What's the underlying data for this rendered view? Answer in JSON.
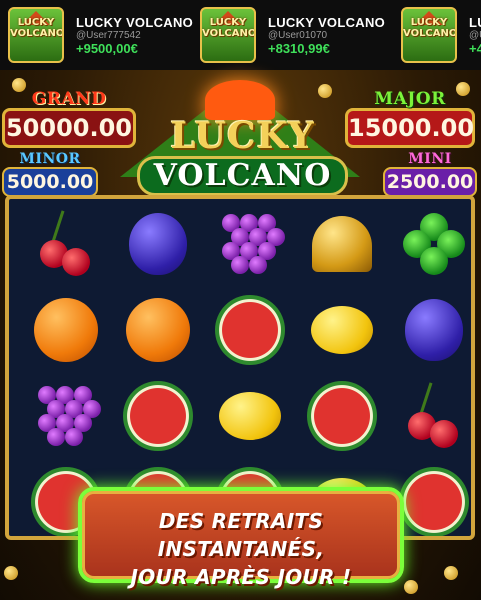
{
  "ticker": [
    {
      "game": "LUCKY VOLCANO",
      "thumb_text": "LUCKY VOLCANO",
      "user": "@User777542",
      "amount": "+9500,00€"
    },
    {
      "game": "LUCKY VOLCANO",
      "thumb_text": "LUCKY VOLCANO",
      "user": "@User01070",
      "amount": "+8310,99€"
    },
    {
      "game": "LU",
      "thumb_text": "LUCKY VOLCANO",
      "user": "@U",
      "amount": "+4"
    }
  ],
  "logo": {
    "line1": "LUCKY",
    "line2": "VOLCANO"
  },
  "jackpots": {
    "grand": {
      "label": "GRAND",
      "value": "50000.00"
    },
    "major": {
      "label": "MAJOR",
      "value": "15000.00"
    },
    "minor": {
      "label": "MINOR",
      "value": "5000.00"
    },
    "mini": {
      "label": "MINI",
      "value": "2500.00"
    }
  },
  "reels": [
    [
      "cherry",
      "orange",
      "grapes",
      "melon"
    ],
    [
      "plum",
      "orange",
      "melon",
      "melon"
    ],
    [
      "grapes",
      "melon",
      "lemon",
      "melon"
    ],
    [
      "bell",
      "lemon",
      "melon",
      "lemon"
    ],
    [
      "clover",
      "plum",
      "cherry",
      "melon"
    ]
  ],
  "banner": {
    "line1": "DES RETRAITS INSTANTANÉS,",
    "line2": "JOUR APRÈS JOUR !"
  },
  "colors": {
    "gold": "#e0b43a",
    "win_green": "#3fe05a",
    "banner_glow": "#7bff3a"
  }
}
